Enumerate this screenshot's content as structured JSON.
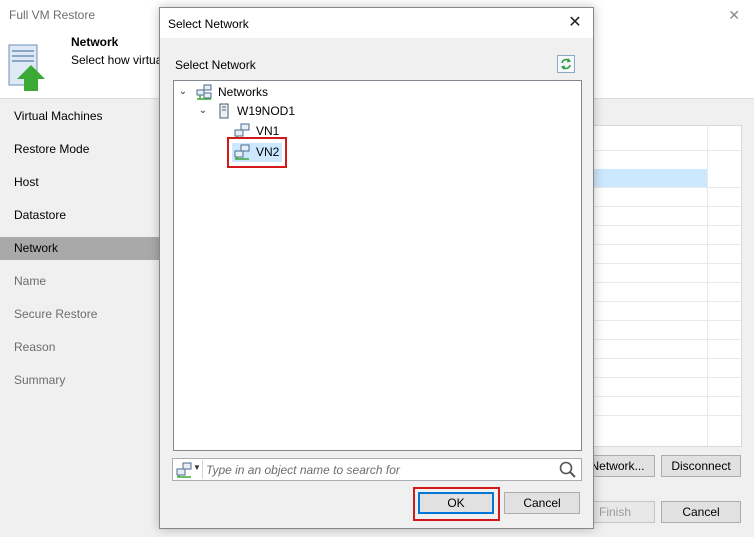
{
  "wizard": {
    "title": "Full VM Restore",
    "header_title": "Network",
    "header_subtitle": "Select how virtua",
    "nav": [
      {
        "label": "Virtual Machines",
        "state": "enabled"
      },
      {
        "label": "Restore Mode",
        "state": "enabled"
      },
      {
        "label": "Host",
        "state": "enabled"
      },
      {
        "label": "Datastore",
        "state": "enabled"
      },
      {
        "label": "Network",
        "state": "active"
      },
      {
        "label": "Name",
        "state": "disabled"
      },
      {
        "label": "Secure Restore",
        "state": "disabled"
      },
      {
        "label": "Reason",
        "state": "disabled"
      },
      {
        "label": "Summary",
        "state": "disabled"
      }
    ],
    "network_button": "Network...",
    "disconnect_button": "Disconnect",
    "finish_button": "Finish",
    "cancel_button": "Cancel"
  },
  "dialog": {
    "title": "Select Network",
    "close_glyph": "✕",
    "label": "Select Network",
    "tree": {
      "root": "Networks",
      "host": "W19NOD1",
      "networks": [
        "VN1",
        "VN2"
      ],
      "selected": "VN2"
    },
    "search_placeholder": "Type in an object name to search for",
    "ok_button": "OK",
    "cancel_button": "Cancel"
  },
  "colors": {
    "selection": "#cce8ff",
    "highlight_frame": "#d11b1b",
    "default_button_border": "#0078d7",
    "active_nav": "#a9a9a9"
  }
}
